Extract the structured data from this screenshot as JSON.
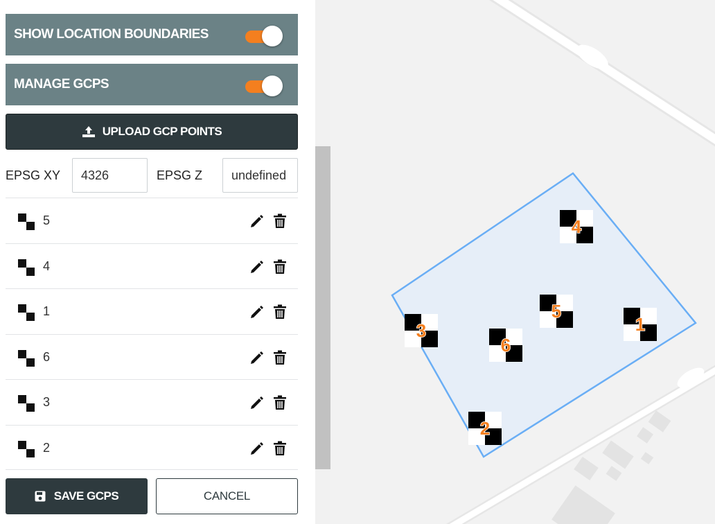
{
  "panel": {
    "toggles": [
      {
        "label": "SHOW LOCATION BOUNDARIES",
        "on": true
      },
      {
        "label": "MANAGE GCPS",
        "on": true
      }
    ],
    "upload_label": "UPLOAD GCP POINTS",
    "epsg_xy_label": "EPSG XY",
    "epsg_xy_value": "4326",
    "epsg_z_label": "EPSG Z",
    "epsg_z_value": "undefined",
    "gcps": [
      {
        "name": "5"
      },
      {
        "name": "4"
      },
      {
        "name": "1"
      },
      {
        "name": "6"
      },
      {
        "name": "3"
      },
      {
        "name": "2"
      }
    ],
    "save_label": "SAVE GCPS",
    "cancel_label": "CANCEL"
  },
  "map": {
    "markers": [
      {
        "label": "4"
      },
      {
        "label": "5"
      },
      {
        "label": "1"
      },
      {
        "label": "3"
      },
      {
        "label": "6"
      },
      {
        "label": "2"
      }
    ]
  },
  "colors": {
    "toggle_bar": "#6b8286",
    "toggle_on": "#f47f1f",
    "dark_button": "#2e3a3e",
    "boundary_stroke": "#6aaef5",
    "boundary_fill": "#e6eef8",
    "marker_label": "#f47f1f"
  },
  "icons": {
    "upload": "upload-icon",
    "save": "floppy-disk-icon",
    "edit": "pencil-icon",
    "delete": "trash-icon",
    "gcp": "checkerboard-marker-icon"
  }
}
